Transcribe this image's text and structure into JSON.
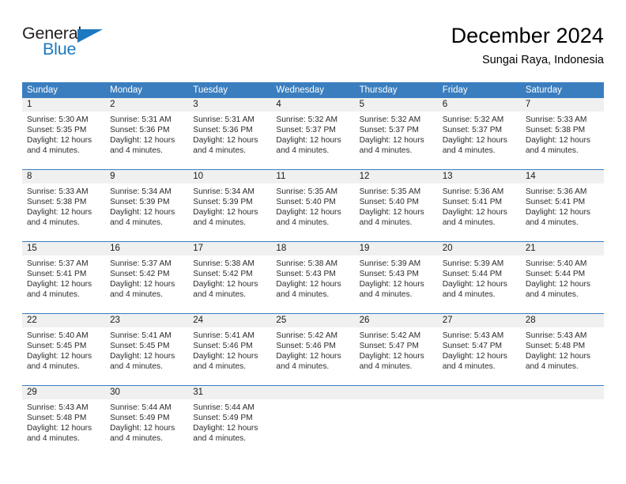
{
  "brand": {
    "name_part1": "General",
    "name_part2": "Blue"
  },
  "header": {
    "title": "December 2024",
    "location": "Sungai Raya, Indonesia"
  },
  "colors": {
    "header_blue": "#3a7ebf",
    "logo_blue": "#1c79c0",
    "date_band": "#f0f0f0",
    "text": "#2b2b2b"
  },
  "day_headers": [
    "Sunday",
    "Monday",
    "Tuesday",
    "Wednesday",
    "Thursday",
    "Friday",
    "Saturday"
  ],
  "weeks": [
    {
      "dates": [
        "1",
        "2",
        "3",
        "4",
        "5",
        "6",
        "7"
      ],
      "cells": [
        {
          "sunrise": "Sunrise: 5:30 AM",
          "sunset": "Sunset: 5:35 PM",
          "daylight1": "Daylight: 12 hours",
          "daylight2": "and 4 minutes."
        },
        {
          "sunrise": "Sunrise: 5:31 AM",
          "sunset": "Sunset: 5:36 PM",
          "daylight1": "Daylight: 12 hours",
          "daylight2": "and 4 minutes."
        },
        {
          "sunrise": "Sunrise: 5:31 AM",
          "sunset": "Sunset: 5:36 PM",
          "daylight1": "Daylight: 12 hours",
          "daylight2": "and 4 minutes."
        },
        {
          "sunrise": "Sunrise: 5:32 AM",
          "sunset": "Sunset: 5:37 PM",
          "daylight1": "Daylight: 12 hours",
          "daylight2": "and 4 minutes."
        },
        {
          "sunrise": "Sunrise: 5:32 AM",
          "sunset": "Sunset: 5:37 PM",
          "daylight1": "Daylight: 12 hours",
          "daylight2": "and 4 minutes."
        },
        {
          "sunrise": "Sunrise: 5:32 AM",
          "sunset": "Sunset: 5:37 PM",
          "daylight1": "Daylight: 12 hours",
          "daylight2": "and 4 minutes."
        },
        {
          "sunrise": "Sunrise: 5:33 AM",
          "sunset": "Sunset: 5:38 PM",
          "daylight1": "Daylight: 12 hours",
          "daylight2": "and 4 minutes."
        }
      ]
    },
    {
      "dates": [
        "8",
        "9",
        "10",
        "11",
        "12",
        "13",
        "14"
      ],
      "cells": [
        {
          "sunrise": "Sunrise: 5:33 AM",
          "sunset": "Sunset: 5:38 PM",
          "daylight1": "Daylight: 12 hours",
          "daylight2": "and 4 minutes."
        },
        {
          "sunrise": "Sunrise: 5:34 AM",
          "sunset": "Sunset: 5:39 PM",
          "daylight1": "Daylight: 12 hours",
          "daylight2": "and 4 minutes."
        },
        {
          "sunrise": "Sunrise: 5:34 AM",
          "sunset": "Sunset: 5:39 PM",
          "daylight1": "Daylight: 12 hours",
          "daylight2": "and 4 minutes."
        },
        {
          "sunrise": "Sunrise: 5:35 AM",
          "sunset": "Sunset: 5:40 PM",
          "daylight1": "Daylight: 12 hours",
          "daylight2": "and 4 minutes."
        },
        {
          "sunrise": "Sunrise: 5:35 AM",
          "sunset": "Sunset: 5:40 PM",
          "daylight1": "Daylight: 12 hours",
          "daylight2": "and 4 minutes."
        },
        {
          "sunrise": "Sunrise: 5:36 AM",
          "sunset": "Sunset: 5:41 PM",
          "daylight1": "Daylight: 12 hours",
          "daylight2": "and 4 minutes."
        },
        {
          "sunrise": "Sunrise: 5:36 AM",
          "sunset": "Sunset: 5:41 PM",
          "daylight1": "Daylight: 12 hours",
          "daylight2": "and 4 minutes."
        }
      ]
    },
    {
      "dates": [
        "15",
        "16",
        "17",
        "18",
        "19",
        "20",
        "21"
      ],
      "cells": [
        {
          "sunrise": "Sunrise: 5:37 AM",
          "sunset": "Sunset: 5:41 PM",
          "daylight1": "Daylight: 12 hours",
          "daylight2": "and 4 minutes."
        },
        {
          "sunrise": "Sunrise: 5:37 AM",
          "sunset": "Sunset: 5:42 PM",
          "daylight1": "Daylight: 12 hours",
          "daylight2": "and 4 minutes."
        },
        {
          "sunrise": "Sunrise: 5:38 AM",
          "sunset": "Sunset: 5:42 PM",
          "daylight1": "Daylight: 12 hours",
          "daylight2": "and 4 minutes."
        },
        {
          "sunrise": "Sunrise: 5:38 AM",
          "sunset": "Sunset: 5:43 PM",
          "daylight1": "Daylight: 12 hours",
          "daylight2": "and 4 minutes."
        },
        {
          "sunrise": "Sunrise: 5:39 AM",
          "sunset": "Sunset: 5:43 PM",
          "daylight1": "Daylight: 12 hours",
          "daylight2": "and 4 minutes."
        },
        {
          "sunrise": "Sunrise: 5:39 AM",
          "sunset": "Sunset: 5:44 PM",
          "daylight1": "Daylight: 12 hours",
          "daylight2": "and 4 minutes."
        },
        {
          "sunrise": "Sunrise: 5:40 AM",
          "sunset": "Sunset: 5:44 PM",
          "daylight1": "Daylight: 12 hours",
          "daylight2": "and 4 minutes."
        }
      ]
    },
    {
      "dates": [
        "22",
        "23",
        "24",
        "25",
        "26",
        "27",
        "28"
      ],
      "cells": [
        {
          "sunrise": "Sunrise: 5:40 AM",
          "sunset": "Sunset: 5:45 PM",
          "daylight1": "Daylight: 12 hours",
          "daylight2": "and 4 minutes."
        },
        {
          "sunrise": "Sunrise: 5:41 AM",
          "sunset": "Sunset: 5:45 PM",
          "daylight1": "Daylight: 12 hours",
          "daylight2": "and 4 minutes."
        },
        {
          "sunrise": "Sunrise: 5:41 AM",
          "sunset": "Sunset: 5:46 PM",
          "daylight1": "Daylight: 12 hours",
          "daylight2": "and 4 minutes."
        },
        {
          "sunrise": "Sunrise: 5:42 AM",
          "sunset": "Sunset: 5:46 PM",
          "daylight1": "Daylight: 12 hours",
          "daylight2": "and 4 minutes."
        },
        {
          "sunrise": "Sunrise: 5:42 AM",
          "sunset": "Sunset: 5:47 PM",
          "daylight1": "Daylight: 12 hours",
          "daylight2": "and 4 minutes."
        },
        {
          "sunrise": "Sunrise: 5:43 AM",
          "sunset": "Sunset: 5:47 PM",
          "daylight1": "Daylight: 12 hours",
          "daylight2": "and 4 minutes."
        },
        {
          "sunrise": "Sunrise: 5:43 AM",
          "sunset": "Sunset: 5:48 PM",
          "daylight1": "Daylight: 12 hours",
          "daylight2": "and 4 minutes."
        }
      ]
    },
    {
      "dates": [
        "29",
        "30",
        "31",
        "",
        "",
        "",
        ""
      ],
      "cells": [
        {
          "sunrise": "Sunrise: 5:43 AM",
          "sunset": "Sunset: 5:48 PM",
          "daylight1": "Daylight: 12 hours",
          "daylight2": "and 4 minutes."
        },
        {
          "sunrise": "Sunrise: 5:44 AM",
          "sunset": "Sunset: 5:49 PM",
          "daylight1": "Daylight: 12 hours",
          "daylight2": "and 4 minutes."
        },
        {
          "sunrise": "Sunrise: 5:44 AM",
          "sunset": "Sunset: 5:49 PM",
          "daylight1": "Daylight: 12 hours",
          "daylight2": "and 4 minutes."
        },
        {
          "sunrise": "",
          "sunset": "",
          "daylight1": "",
          "daylight2": ""
        },
        {
          "sunrise": "",
          "sunset": "",
          "daylight1": "",
          "daylight2": ""
        },
        {
          "sunrise": "",
          "sunset": "",
          "daylight1": "",
          "daylight2": ""
        },
        {
          "sunrise": "",
          "sunset": "",
          "daylight1": "",
          "daylight2": ""
        }
      ]
    }
  ]
}
